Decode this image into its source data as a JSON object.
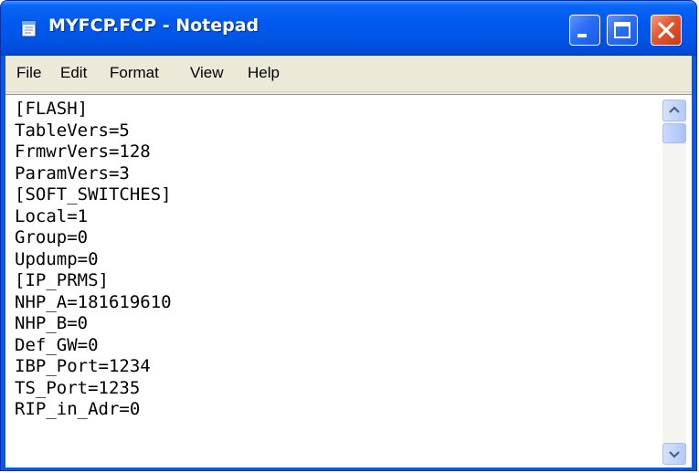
{
  "window": {
    "title": "MYFCP.FCP - Notepad",
    "app_icon": "notepad-icon",
    "controls": {
      "minimize_icon": "minimize-icon",
      "maximize_icon": "maximize-icon",
      "close_icon": "close-icon"
    },
    "colors": {
      "titlebar": "#0058ee",
      "close_button": "#e2572f",
      "menubar": "#ece9d8"
    }
  },
  "menubar": {
    "items": [
      {
        "label": "File"
      },
      {
        "label": "Edit"
      },
      {
        "label": "Format"
      },
      {
        "label": "View"
      },
      {
        "label": "Help"
      }
    ]
  },
  "document": {
    "lines": [
      "[FLASH]",
      "TableVers=5",
      "FrmwrVers=128",
      "ParamVers=3",
      "[SOFT_SWITCHES]",
      "Local=1",
      "Group=0",
      "Updump=0",
      "[IP_PRMS]",
      "NHP_A=181619610",
      "NHP_B=0",
      "Def_GW=0",
      "IBP_Port=1234",
      "TS_Port=1235",
      "RIP_in_Adr=0"
    ]
  },
  "scrollbar": {
    "up_icon": "scroll-up-arrow-icon",
    "down_icon": "scroll-down-arrow-icon"
  }
}
